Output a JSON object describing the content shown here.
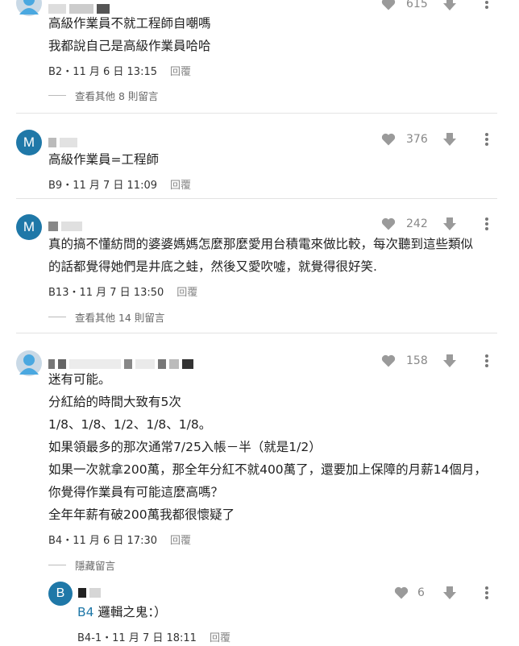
{
  "comments": [
    {
      "id": "b2",
      "lines": [
        "高級作業員不就工程師自嘲嗎",
        "我都說自己是高級作業員哈哈"
      ],
      "meta": "B2・11 月 6 日 13:15",
      "likes": "615",
      "more": "查看其他 8 則留言"
    },
    {
      "id": "b9",
      "avatar_letter": "M",
      "lines": [
        "高級作業員=工程師"
      ],
      "meta": "B9・11 月 7 日 11:09",
      "likes": "376"
    },
    {
      "id": "b13",
      "avatar_letter": "M",
      "lines": [
        "真的搞不懂紡問的婆婆媽媽怎麼那麼愛用台積電來做比較，每次聽到這些類似",
        "的話都覺得她們是井底之蛙，然後又愛吹噓，就覺得很好笑."
      ],
      "meta": "B13・11 月 7 日 13:50",
      "likes": "242",
      "more": "查看其他 14 則留言"
    },
    {
      "id": "b4",
      "lines": [
        "迷有可能。",
        "分紅給的時間大致有5次",
        "1/8、1/8、1/2、1/8、1/8。",
        "如果領最多的那次通常7/25入帳－半（就是1/2）",
        "如果一次就拿200萬，那全年分紅不就400萬了，還要加上保障的月薪14個月，",
        "你覺得作業員有可能這麼高嗎？",
        "全年年薪有破200萬我都很懷疑了"
      ],
      "meta": "B4・11 月 6 日 17:30",
      "likes": "158",
      "hide": "隱藏留言"
    },
    {
      "id": "b4-1",
      "avatar_letter": "B",
      "tag": "B4",
      "text": " 邏輯之鬼：）",
      "meta": "B4-1・11 月 7 日 18:11",
      "likes": "6"
    }
  ],
  "reply_label": "回覆",
  "colors": {
    "accent": "#1f78a8",
    "icon_grey": "#9a9a9a",
    "text": "#222222",
    "meta_grey": "#888888"
  }
}
